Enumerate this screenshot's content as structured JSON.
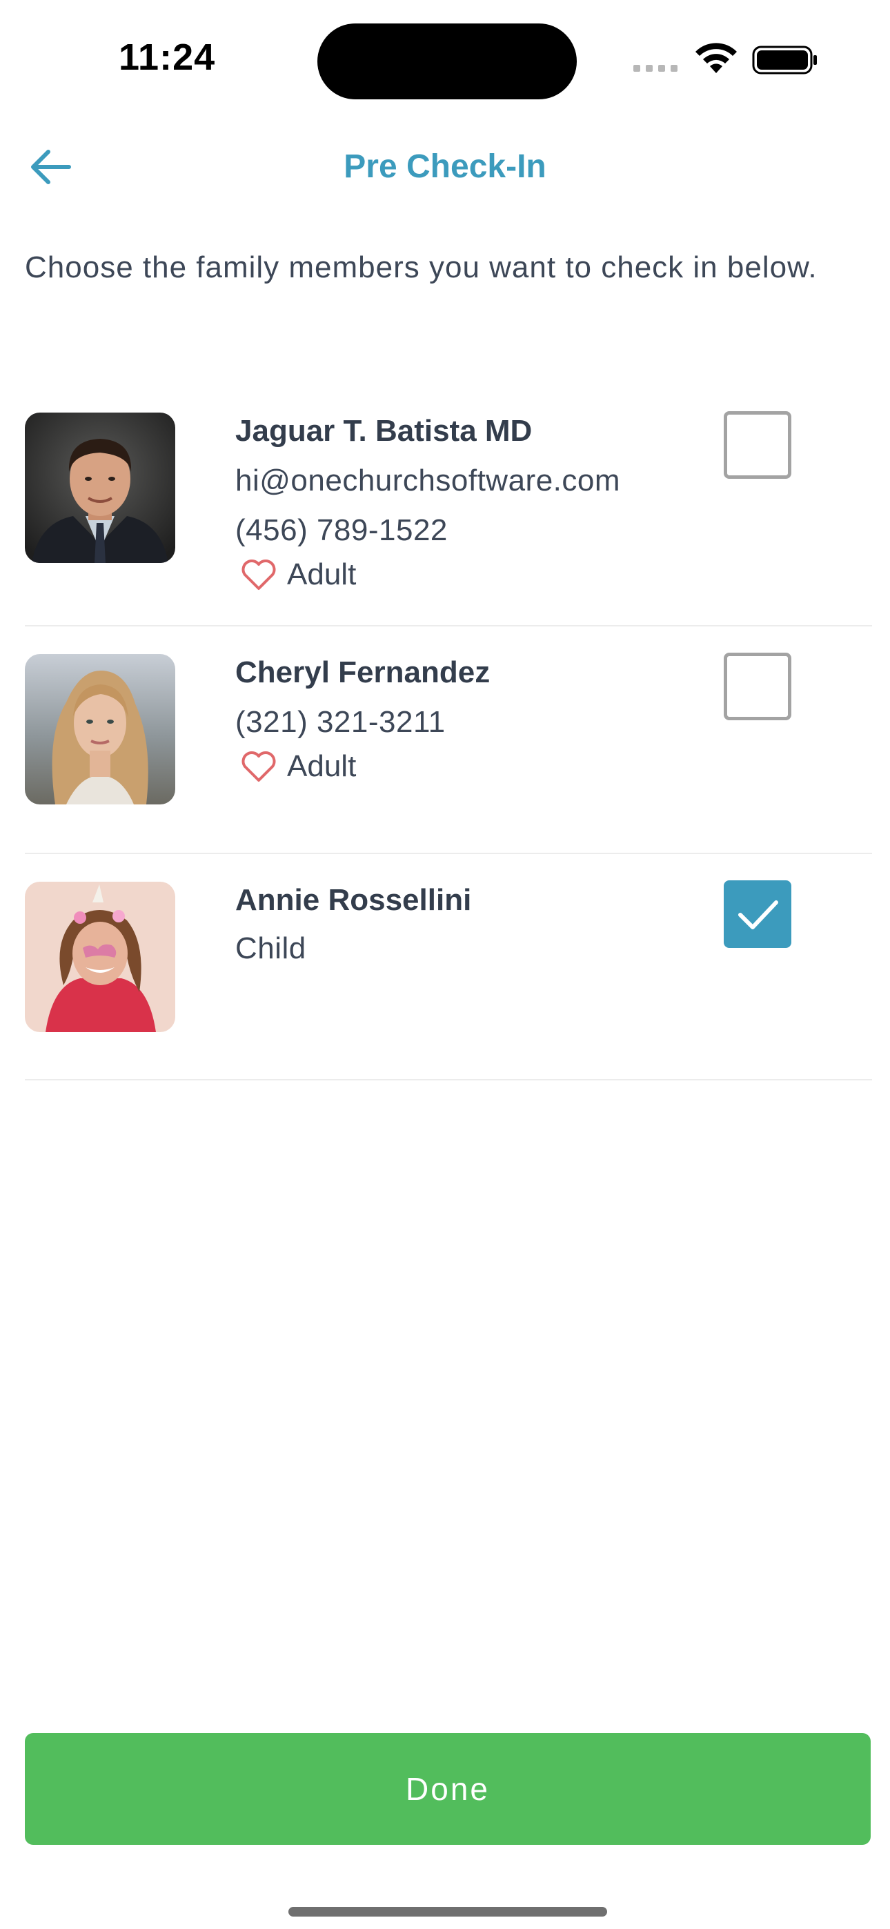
{
  "status_bar": {
    "time": "11:24"
  },
  "header": {
    "title": "Pre Check-In"
  },
  "intro": "Choose the family members you want to check in below.",
  "members": [
    {
      "name": "Jaguar T. Batista MD",
      "email": "hi@onechurchsoftware.com",
      "phone": "(456) 789-1522",
      "role": "Adult",
      "checked": false
    },
    {
      "name": "Cheryl Fernandez",
      "phone": "(321) 321-3211",
      "role": "Adult",
      "checked": false
    },
    {
      "name": "Annie Rossellini",
      "role": "Child",
      "checked": true
    }
  ],
  "done_label": "Done",
  "colors": {
    "accent": "#3c9bbd",
    "done": "#52bd5c",
    "heart": "#e0686a"
  }
}
